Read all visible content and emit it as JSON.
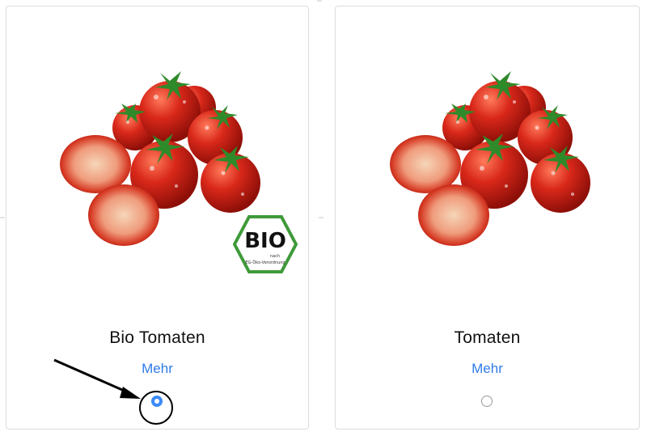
{
  "products": [
    {
      "title": "Bio Tomaten",
      "more_label": "Mehr",
      "selected": true,
      "image": "tomatoes-with-bio-seal",
      "seal": {
        "main": "BIO",
        "line1": "nach",
        "line2": "EG-Öko-Verordnung"
      }
    },
    {
      "title": "Tomaten",
      "more_label": "Mehr",
      "selected": false,
      "image": "tomatoes"
    }
  ],
  "annotation": {
    "arrow_icon": "arrow-pointer",
    "highlight": "circle"
  },
  "colors": {
    "link": "#2f7be8",
    "radio_selected": "#3d8af7",
    "tomato": "#d42a1a",
    "leaf": "#2f8a2a",
    "seal": "#3f9a3a"
  }
}
